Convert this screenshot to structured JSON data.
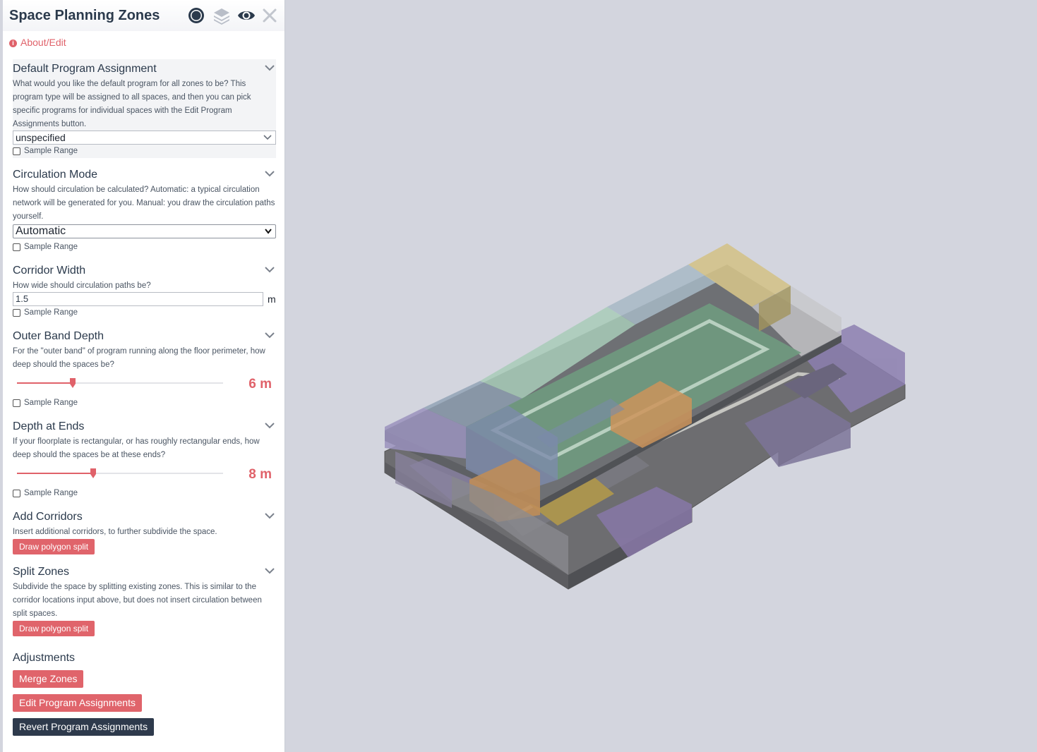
{
  "header": {
    "title": "Space Planning Zones",
    "icons": [
      "record-icon",
      "layers-icon",
      "eye-icon",
      "close-icon"
    ]
  },
  "about_link": "About/Edit",
  "sample_range_label": "Sample Range",
  "sections": {
    "default_program": {
      "title": "Default Program Assignment",
      "description": "What would you like the default program for all zones to be? This program type will be assigned to all spaces, and then you can pick specific programs for individual spaces with the Edit Program Assignments button.",
      "selected": "unspecified"
    },
    "circulation_mode": {
      "title": "Circulation Mode",
      "description": "How should circulation be calculated? Automatic: a typical circulation network will be generated for you. Manual: you draw the circulation paths yourself.",
      "selected": "Automatic"
    },
    "corridor_width": {
      "title": "Corridor Width",
      "description": "How wide should circulation paths be?",
      "value": "1.5",
      "unit": "m"
    },
    "outer_band_depth": {
      "title": "Outer Band Depth",
      "description": "For the \"outer band\" of program running along the floor perimeter, how deep should the spaces be?",
      "value_label": "6 m",
      "slider_fraction": 0.27
    },
    "depth_at_ends": {
      "title": "Depth at Ends",
      "description": "If your floorplate is rectangular, or has roughly rectangular ends, how deep should the spaces be at these ends?",
      "value_label": "8 m",
      "slider_fraction": 0.37
    },
    "add_corridors": {
      "title": "Add Corridors",
      "description": "Insert additional corridors, to further subdivide the space.",
      "button": "Draw polygon split"
    },
    "split_zones": {
      "title": "Split Zones",
      "description": "Subdivide the space by splitting existing zones. This is similar to the corridor locations input above, but does not insert circulation between split spaces.",
      "button": "Draw polygon split"
    }
  },
  "adjustments": {
    "title": "Adjustments",
    "merge": "Merge Zones",
    "edit": "Edit Program Assignments",
    "revert": "Revert Program Assignments"
  },
  "colors": {
    "accent": "#e0646b",
    "dark_button": "#2e3a4c",
    "viewport_bg": "#d3d5de"
  }
}
